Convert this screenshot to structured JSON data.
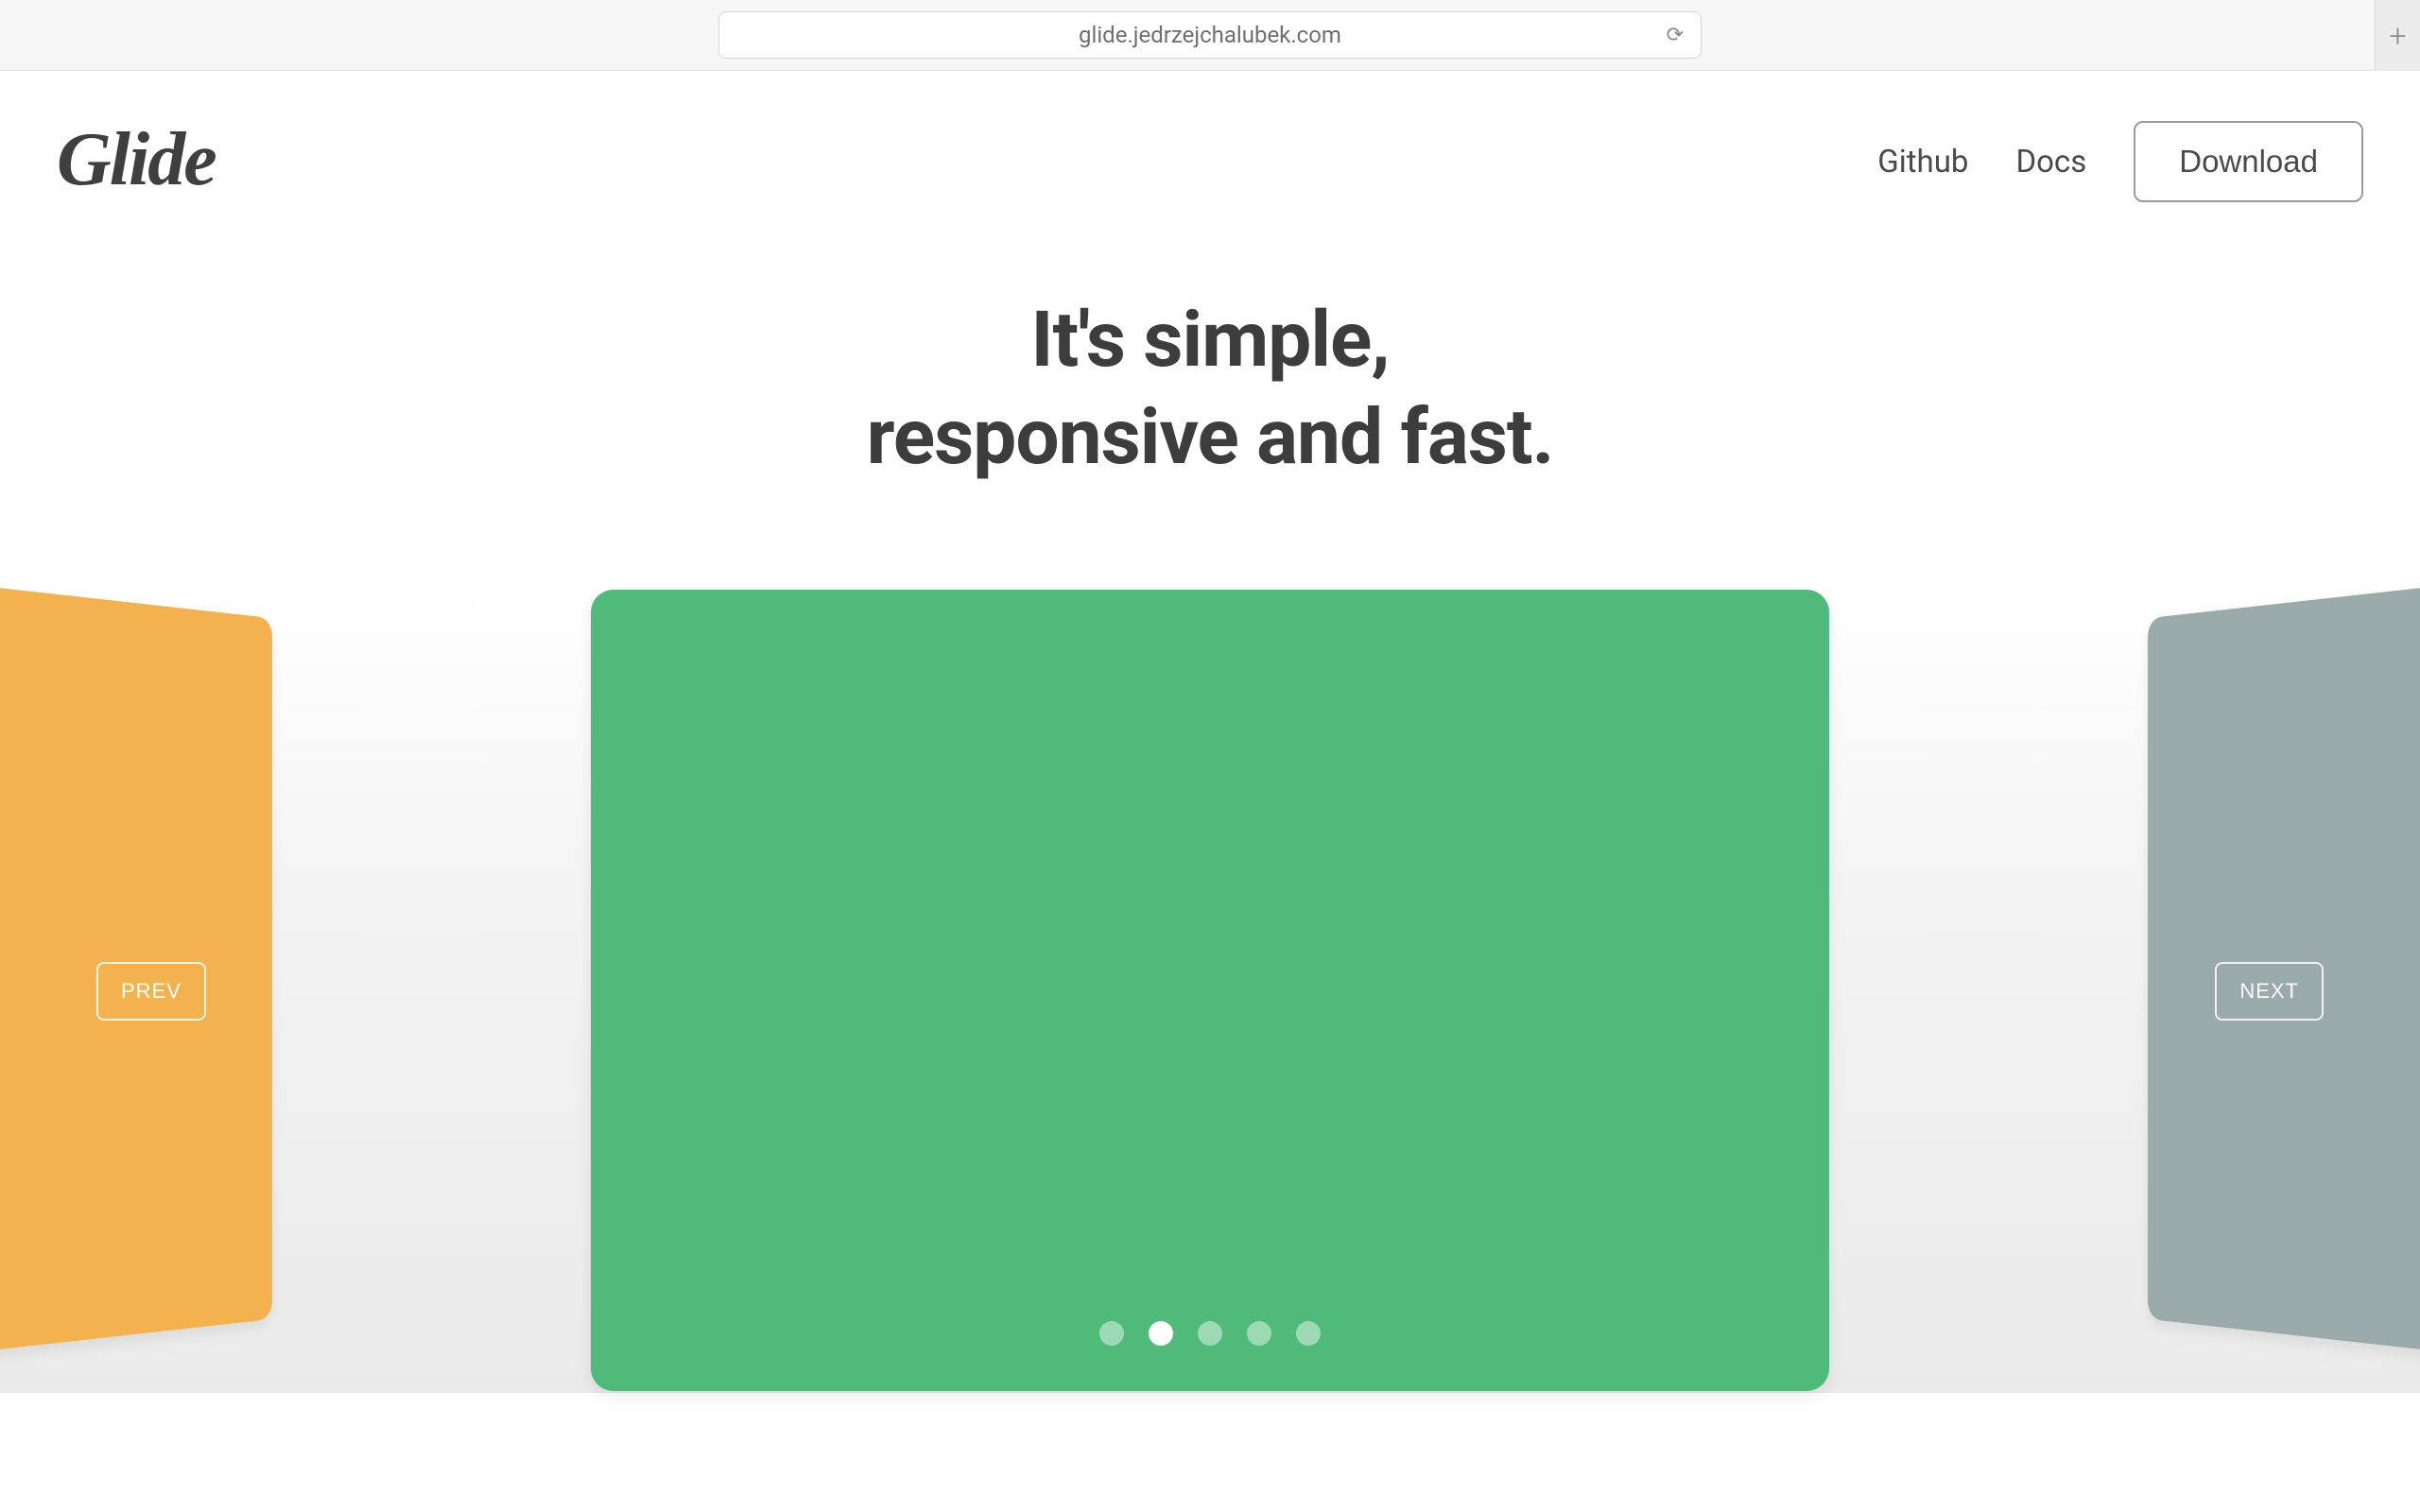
{
  "browser": {
    "url": "glide.jedrzejchalubek.com"
  },
  "header": {
    "logo_text": "Glide",
    "nav": {
      "github": "Github",
      "docs": "Docs",
      "download": "Download"
    }
  },
  "hero": {
    "line1": "It's simple,",
    "line2": "responsive and fast."
  },
  "carousel": {
    "prev_label": "PREV",
    "next_label": "NEXT",
    "slides": [
      {
        "color": "#f3b24d"
      },
      {
        "color": "#4fba7a"
      },
      {
        "color": "#9aa9aa"
      },
      {
        "color": "#cccccc"
      },
      {
        "color": "#cccccc"
      }
    ],
    "active_index": 1,
    "dot_count": 5
  }
}
